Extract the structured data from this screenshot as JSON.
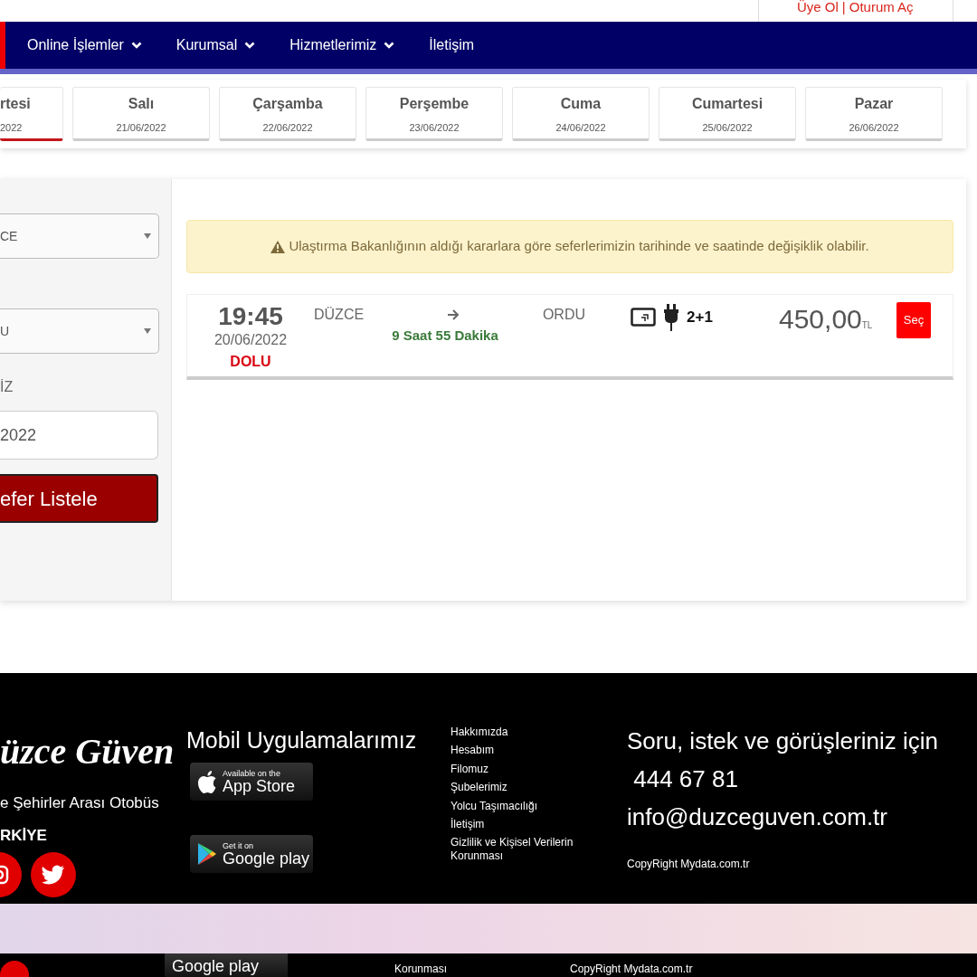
{
  "header": {
    "links": [
      {
        "label": "Üye Ol"
      },
      {
        "label": "Oturum Aç"
      }
    ],
    "separator": "|"
  },
  "nav": [
    {
      "label": "Online İşlemler",
      "dropdown": true
    },
    {
      "label": "Kurumsal",
      "dropdown": true
    },
    {
      "label": "Hizmetlerimiz",
      "dropdown": true
    },
    {
      "label": "İletişim",
      "dropdown": false
    }
  ],
  "days": [
    {
      "day": "rtesi",
      "date": "2022",
      "selected": true
    },
    {
      "day": "Salı",
      "date": "21/06/2022",
      "selected": false
    },
    {
      "day": "Çarşamba",
      "date": "22/06/2022",
      "selected": false
    },
    {
      "day": "Perşembe",
      "date": "23/06/2022",
      "selected": false
    },
    {
      "day": "Cuma",
      "date": "24/06/2022",
      "selected": false
    },
    {
      "day": "Cumartesi",
      "date": "25/06/2022",
      "selected": false
    },
    {
      "day": "Pazar",
      "date": "26/06/2022",
      "selected": false
    }
  ],
  "search": [
    {
      "kind": "select",
      "value": "CE"
    },
    {
      "kind": "select",
      "value": "U"
    },
    {
      "kind": "label",
      "text": "İZ"
    },
    {
      "kind": "input",
      "value": "2022"
    },
    {
      "kind": "button",
      "text": "efer Listele"
    }
  ],
  "notice": "Ulaştırma Bakanlığının aldığı kararlara göre seferlerimizin tarihinde ve saatinde değişiklik olabilir.",
  "trips": [
    {
      "time": "19:45",
      "date": "20/06/2022",
      "status": "DOLU",
      "from": "DÜZCE",
      "to": "ORDU",
      "duration": "9 Saat 55 Dakika",
      "seating": "2+1",
      "price": "450,00",
      "currency": "TL",
      "button": "Seç"
    }
  ],
  "footer": {
    "brand": "üzce Güven",
    "tagline": "e Şehirler Arası Otobüs",
    "country": "RKİYE",
    "apps_title": "Mobil Uygulamalarımız",
    "badges": [
      {
        "kind": "apple",
        "small": "Available on the",
        "big": "App Store"
      },
      {
        "kind": "google",
        "small": "Get it on",
        "big": "Google play"
      }
    ],
    "links": [
      "Hakkımızda",
      "Hesabım",
      "Filomuz",
      "Şubelerimiz",
      "Yolcu Taşımacılığı",
      "İletişim",
      "Gizlilik ve Kişisel Verilerin Korunması"
    ],
    "contact_title": "Soru, istek ve görüşleriniz için",
    "phone": " 444 67 81",
    "email": "info@duzceguven.com.tr",
    "copyright": "CopyRight Mydata.com.tr"
  },
  "repeat_strip": {
    "badge": "Google play",
    "link": "Korunması",
    "copyright": "CopyRight Mydata.com.tr"
  }
}
